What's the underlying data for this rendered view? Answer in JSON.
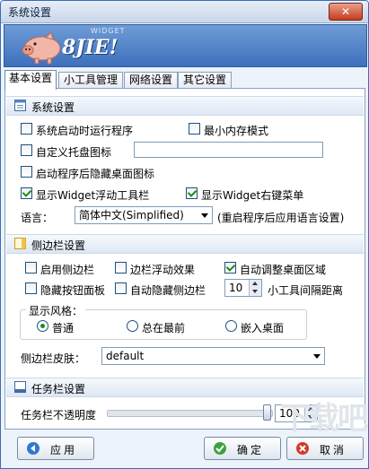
{
  "window": {
    "title": "系统设置",
    "close_label": "✕"
  },
  "banner": {
    "logo_text": "8JIE!",
    "logo_sub": "WIDGET"
  },
  "tabs": [
    {
      "label": "基本设置",
      "active": true
    },
    {
      "label": "小工具管理",
      "active": false
    },
    {
      "label": "网络设置",
      "active": false
    },
    {
      "label": "其它设置",
      "active": false
    }
  ],
  "system": {
    "header": "系统设置",
    "run_on_startup": {
      "label": "系统启动时运行程序",
      "checked": false
    },
    "min_memory": {
      "label": "最小内存模式",
      "checked": false
    },
    "custom_tray": {
      "label": "自定义托盘图标",
      "checked": false,
      "value": ""
    },
    "hide_desktop_icons": {
      "label": "启动程序后隐藏桌面图标",
      "checked": false
    },
    "show_toolbar": {
      "label": "显示Widget浮动工具栏",
      "checked": true
    },
    "show_context_menu": {
      "label": "显示Widget右键菜单",
      "checked": true
    },
    "language_label": "语言：",
    "language_value": "简体中文(Simplified)",
    "language_note": "(重启程序后应用语言设置)"
  },
  "sidebar": {
    "header": "侧边栏设置",
    "enable": {
      "label": "启用侧边栏",
      "checked": false
    },
    "float_effect": {
      "label": "边栏浮动效果",
      "checked": false
    },
    "auto_adjust": {
      "label": "自动调整桌面区域",
      "checked": true
    },
    "hide_button_panel": {
      "label": "隐藏按钮面板",
      "checked": false
    },
    "auto_hide": {
      "label": "自动隐藏侧边栏",
      "checked": false
    },
    "spacing_value": "10",
    "spacing_label": "小工具间隔距离",
    "style_label": "显示风格：",
    "styles": [
      {
        "label": "普通",
        "selected": true
      },
      {
        "label": "总在最前",
        "selected": false
      },
      {
        "label": "嵌入桌面",
        "selected": false
      }
    ],
    "skin_label": "侧边栏皮肤：",
    "skin_value": "default"
  },
  "taskbar": {
    "header": "任务栏设置",
    "opacity_label": "任务栏不透明度",
    "opacity_value": "100",
    "opacity_fraction": 1.0
  },
  "footer": {
    "apply_label": "应用",
    "ok_label": "确定",
    "cancel_label": "取消"
  },
  "watermark": "下载吧",
  "colors": {
    "accent": "#3d70bd",
    "check": "#1c8a1c",
    "cancel": "#c63b1f"
  }
}
